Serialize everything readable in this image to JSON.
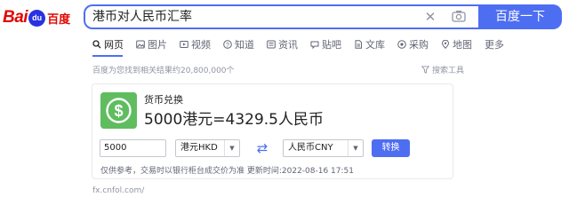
{
  "logo": {
    "bai": "Bai",
    "paw": "du",
    "du": "",
    "zh": "百度"
  },
  "search": {
    "query": "港币对人民币汇率",
    "button_label": "百度一下",
    "clear_glyph": "✕"
  },
  "tabs": [
    {
      "label": "网页",
      "icon": "search-icon",
      "active": true
    },
    {
      "label": "图片",
      "icon": "image-icon"
    },
    {
      "label": "视频",
      "icon": "video-icon"
    },
    {
      "label": "知道",
      "icon": "question-icon"
    },
    {
      "label": "资讯",
      "icon": "news-icon"
    },
    {
      "label": "贴吧",
      "icon": "tieba-icon"
    },
    {
      "label": "文库",
      "icon": "document-icon"
    },
    {
      "label": "采购",
      "icon": "purchase-icon"
    },
    {
      "label": "地图",
      "icon": "map-icon"
    },
    {
      "label": "更多",
      "icon": ""
    }
  ],
  "result_count": "百度为您找到相关结果约20,800,000个",
  "tools_label": "搜索工具",
  "card": {
    "title": "货币兑换",
    "result": "5000港元=4329.5人民币",
    "amount": "5000",
    "from_currency": "港元HKD",
    "to_currency": "人民币CNY",
    "convert_label": "转换",
    "disclaimer": "仅供参考，交易时以银行柜台成交价为准 更新时间:2022-08-16 17:51",
    "swap_glyph": "⇄",
    "icon_color": "#5fbd5f"
  },
  "site_url": "fx.cnfol.com/",
  "colors": {
    "accent": "#4e6ef2",
    "logo_red": "#e10602",
    "logo_blue": "#2932e1"
  }
}
